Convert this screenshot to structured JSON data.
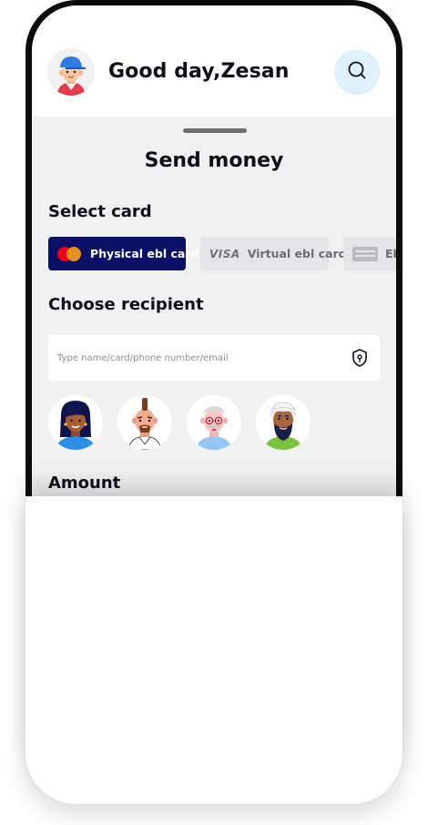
{
  "header": {
    "greeting": "Good day,Zesan",
    "avatar_icon": "user-avatar-icon",
    "search_icon": "search-icon"
  },
  "sheet": {
    "title": "Send money",
    "select_card_label": "Select card",
    "cards": [
      {
        "label": "Physical ebl card",
        "brand": "mastercard",
        "selected": true
      },
      {
        "label": "Virtual ebl card",
        "brand": "VISA",
        "selected": false
      },
      {
        "label": "Eb",
        "brand": "amex",
        "selected": false
      }
    ],
    "choose_recipient_label": "Choose recipient",
    "search": {
      "placeholder": "Type name/card/phone number/email",
      "value": "",
      "icon": "shield-lock-icon"
    },
    "recipients": [
      {
        "icon": "recipient-avatar-woman"
      },
      {
        "icon": "recipient-avatar-mohawk-man"
      },
      {
        "icon": "recipient-avatar-elder-man"
      },
      {
        "icon": "recipient-avatar-turban-man"
      }
    ],
    "amount_label": "Amount"
  },
  "colors": {
    "primary": "#0a1066",
    "search_bg": "#ddf1fb",
    "sheet_bg": "#f0f1f1",
    "chip_inactive": "#e4e5e7",
    "text": "#0d0f1c"
  }
}
